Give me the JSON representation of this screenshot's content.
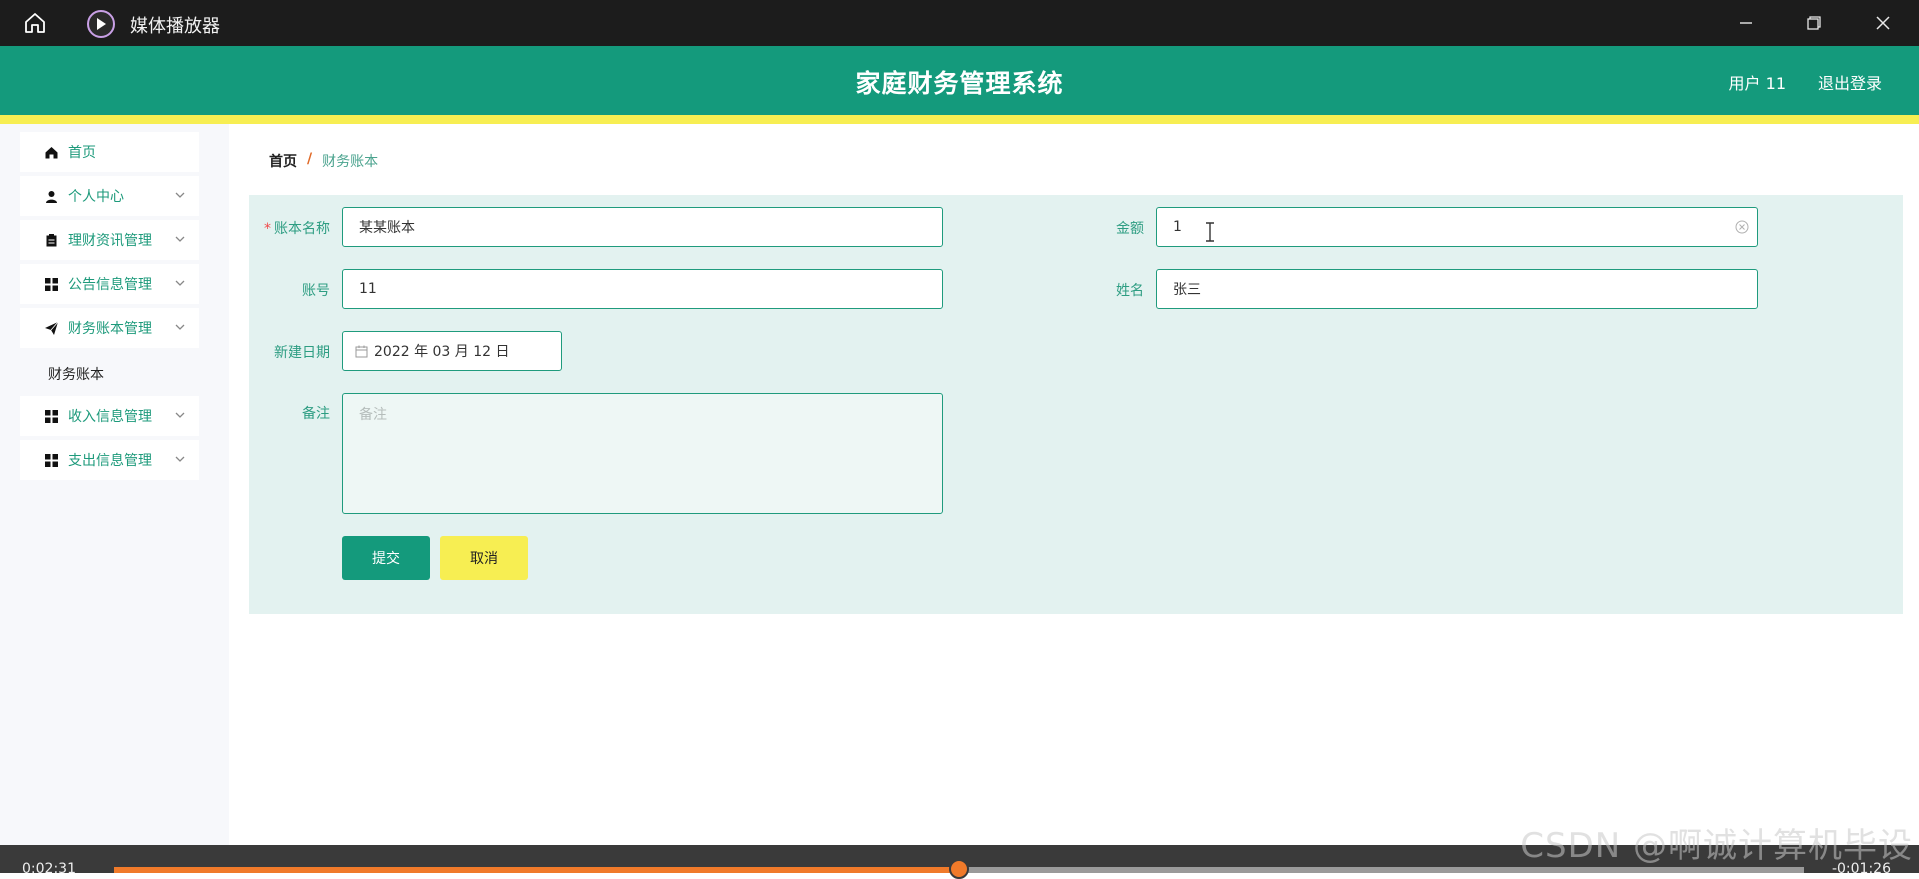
{
  "titlebar": {
    "title": "媒体播放器",
    "icons": [
      "home-icon",
      "media-player-icon",
      "minimize-icon",
      "restore-icon",
      "close-icon"
    ]
  },
  "header": {
    "title": "家庭财务管理系统",
    "user": "用户 11",
    "logout": "退出登录",
    "colors": {
      "primary": "#149a7c",
      "stripe": "#f7ee52"
    }
  },
  "sidebar": {
    "items": [
      {
        "label": "首页",
        "icon": "home-icon"
      },
      {
        "label": "个人中心",
        "icon": "user-icon"
      },
      {
        "label": "理财资讯管理",
        "icon": "clipboard-icon"
      },
      {
        "label": "公告信息管理",
        "icon": "grid-icon"
      },
      {
        "label": "财务账本管理",
        "icon": "paper-plane-icon"
      },
      {
        "label": "收入信息管理",
        "icon": "grid-icon"
      },
      {
        "label": "支出信息管理",
        "icon": "grid-icon"
      }
    ],
    "submenu": {
      "label": "财务账本"
    }
  },
  "breadcrumb": {
    "home": "首页",
    "sep": "/",
    "current": "财务账本"
  },
  "form": {
    "account_name": {
      "label": "账本名称",
      "value": "某某账本"
    },
    "amount": {
      "label": "金额",
      "value": "1"
    },
    "account_no": {
      "label": "账号",
      "value": "11"
    },
    "name": {
      "label": "姓名",
      "value": "张三"
    },
    "date": {
      "label": "新建日期",
      "value": "2022 年 03 月 12 日"
    },
    "remark": {
      "label": "备注",
      "placeholder": "备注"
    },
    "submit": "提交",
    "cancel": "取消"
  },
  "player": {
    "elapsed": "0:02:31",
    "remaining": "-0:01:26",
    "progress": 0.5
  },
  "watermark": "CSDN @啊诚计算机毕设"
}
